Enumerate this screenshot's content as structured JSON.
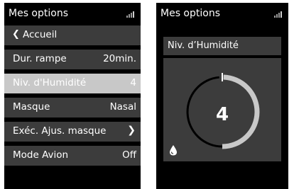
{
  "left_screen": {
    "header": {
      "title": "Mes options"
    },
    "menu": [
      {
        "label": "Accueil",
        "value": "",
        "icon": "chevron-left-icon",
        "selected": false
      },
      {
        "label": "Dur. rampe",
        "value": "20min.",
        "selected": false
      },
      {
        "label": "Niv. d'Humidité",
        "value": "4",
        "selected": true
      },
      {
        "label": "Masque",
        "value": "Nasal",
        "selected": false
      },
      {
        "label": "Exéc. Ajus. masque",
        "value": "",
        "icon": "chevron-right-icon",
        "selected": false
      },
      {
        "label": "Mode Avion",
        "value": "Off",
        "selected": false
      }
    ]
  },
  "right_screen": {
    "header": {
      "title": "Mes options"
    },
    "detail_title": "Niv. d’Humidité",
    "gauge": {
      "value": "4",
      "level": 4,
      "max": 8,
      "icon": "water-drop-icon"
    }
  },
  "colors": {
    "background": "#000000",
    "item": "#3c3c3c",
    "selected": "#c8c8c8",
    "text": "#ffffff",
    "gauge_track": "#c8c8c8"
  },
  "icons": {
    "signal": "signal-strength-icon"
  }
}
